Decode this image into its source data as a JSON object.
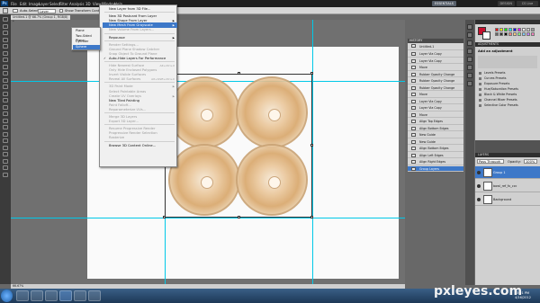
{
  "app": {
    "logo": "Ps",
    "menu": [
      "File",
      "Edit",
      "Image",
      "Layer",
      "Select",
      "Filter",
      "Analysis",
      "3D",
      "View",
      "Window",
      "Help"
    ],
    "workspaces": [
      "ESSENTIALS",
      "DESIGN"
    ],
    "cs_live": "CS Live"
  },
  "options": {
    "tool": "Auto-Select",
    "target": "Layer",
    "transform": "Show Transform Controls"
  },
  "document": {
    "tab": "Untitled-1 @ 66.7% (Group 1, RGB/8) *",
    "status": "66.67%"
  },
  "menu3d": {
    "items": [
      {
        "label": "New Layer from 3D File...",
        "state": "normal"
      },
      {
        "sep": true
      },
      {
        "label": "New 3D Postcard From Layer",
        "state": "normal"
      },
      {
        "label": "New Shape From Layer",
        "state": "normal",
        "arrow": true
      },
      {
        "label": "New Mesh From Grayscale",
        "state": "highlight",
        "arrow": true
      },
      {
        "label": "New Volume From Layers...",
        "state": "disabled"
      },
      {
        "sep": true
      },
      {
        "label": "Repousse",
        "state": "normal",
        "arrow": true
      },
      {
        "sep": true
      },
      {
        "label": "Render Settings...",
        "state": "disabled"
      },
      {
        "label": "Ground Plane Shadow Catcher",
        "state": "disabled"
      },
      {
        "label": "Snap Object To Ground Plane",
        "state": "disabled"
      },
      {
        "label": "Auto-Hide Layers For Performance",
        "state": "normal",
        "check": true
      },
      {
        "sep": true
      },
      {
        "label": "Hide Nearest Surface",
        "state": "disabled",
        "shortcut": "Alt+Ctrl+X"
      },
      {
        "label": "Only Hide Enclosed Polygons",
        "state": "disabled"
      },
      {
        "label": "Invert Visible Surfaces",
        "state": "disabled"
      },
      {
        "label": "Reveal All Surfaces",
        "state": "disabled",
        "shortcut": "Alt+Shift+Ctrl+X"
      },
      {
        "sep": true
      },
      {
        "label": "3D Paint Mode",
        "state": "disabled",
        "arrow": true
      },
      {
        "label": "Select Paintable Areas",
        "state": "disabled"
      },
      {
        "label": "Create UV Overlays",
        "state": "disabled",
        "arrow": true
      },
      {
        "label": "New Tiled Painting",
        "state": "normal"
      },
      {
        "label": "Paint Falloff...",
        "state": "disabled"
      },
      {
        "label": "Reparameterize UVs...",
        "state": "disabled"
      },
      {
        "sep": true
      },
      {
        "label": "Merge 3D Layers",
        "state": "disabled"
      },
      {
        "label": "Export 3D Layer...",
        "state": "disabled"
      },
      {
        "sep": true
      },
      {
        "label": "Resume Progressive Render",
        "state": "disabled"
      },
      {
        "label": "Progressive Render Selection",
        "state": "disabled"
      },
      {
        "label": "Rasterize",
        "state": "disabled"
      },
      {
        "sep": true
      },
      {
        "label": "Browse 3D Content Online...",
        "state": "normal"
      }
    ]
  },
  "submenu": {
    "items": [
      {
        "label": "Plane",
        "state": "normal"
      },
      {
        "label": "Two-Sided Plane",
        "state": "normal"
      },
      {
        "label": "Cylinder",
        "state": "normal"
      },
      {
        "label": "Sphere",
        "state": "highlight"
      }
    ]
  },
  "history": {
    "title": "HISTORY",
    "doc": "Untitled-1",
    "rows": [
      "Layer Via Copy",
      "Layer Via Copy",
      "Move",
      "Rubber Opacity Change",
      "Rubber Opacity Change",
      "Rubber Opacity Change",
      "Move",
      "Layer Via Copy",
      "Layer Via Copy",
      "Move",
      "Align Top Edges",
      "Align Bottom Edges",
      "New Guide",
      "New Guide",
      "Align Bottom Edges",
      "Align Left Edges",
      "Align Right Edges",
      "Group Layers"
    ],
    "selected": 17
  },
  "adjustments": {
    "tabs": [
      "ADJUSTMENTS",
      "MASKS"
    ],
    "title": "Add an adjustment",
    "presets": [
      "Levels Presets",
      "Curves Presets",
      "Exposure Presets",
      "Hue/Saturation Presets",
      "Black & White Presets",
      "Channel Mixer Presets",
      "Selective Color Presets"
    ]
  },
  "colors": {
    "accent": "#3d78c8",
    "swatches": [
      "#ff0000",
      "#ffff00",
      "#00ff00",
      "#00ffff",
      "#0000ff",
      "#ff00ff",
      "#ffffff",
      "#cccccc",
      "#999999",
      "#666666",
      "#333333",
      "#000000",
      "#ff8080",
      "#ffcc80",
      "#80ff80",
      "#80ccff",
      "#c080ff",
      "#ff80c0"
    ]
  },
  "layers": {
    "tabs": [
      "LAYERS",
      "CHANNELS",
      "PATHS"
    ],
    "blend": "Pass Through",
    "opacity_label": "Opacity:",
    "opacity": "100%",
    "rows": [
      {
        "label": "Group 1",
        "selected": true
      },
      {
        "label": "bowl_ref_fx_ccc",
        "selected": false
      },
      {
        "label": "Background",
        "selected": false
      }
    ]
  },
  "watermark": {
    "text": "pxl",
    "text2": "eyes.com"
  },
  "taskbar": {
    "clock": "3:21 PM",
    "date": "4/16/2012"
  }
}
